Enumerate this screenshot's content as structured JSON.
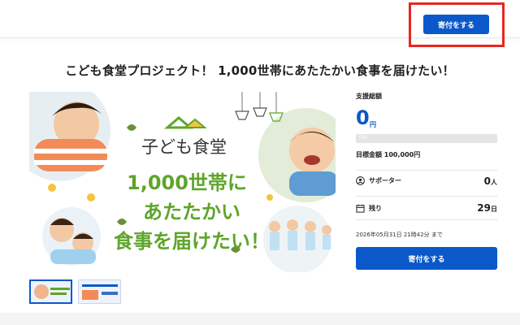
{
  "header": {
    "donate_label": "寄付をする"
  },
  "title": "こども食堂プロジェクト！ 1,000世帯にあたたかい食事を届けたい！",
  "hero": {
    "brand": "子ども食堂",
    "line1": "1,000世帯に",
    "line2": "あたたかい",
    "line3": "食事を届けたい！"
  },
  "thumbnails": [
    "thumbnail-1",
    "thumbnail-2"
  ],
  "panel": {
    "total_label": "支援総額",
    "amount": "0",
    "amount_unit": "円",
    "progress_text": "0%",
    "progress_fraction": 0,
    "goal": "目標金額 100,000円",
    "supporters_label": "サポーター",
    "supporters_value": "0",
    "supporters_unit": "人",
    "remaining_label": "残り",
    "remaining_value": "29",
    "remaining_unit": "日",
    "deadline": "2026年05月31日 21時42分 まで",
    "donate_label": "寄付をする"
  },
  "colors": {
    "accent": "#0a58c9",
    "highlight": "#e8261e",
    "hero_text": "#5ea52a"
  }
}
